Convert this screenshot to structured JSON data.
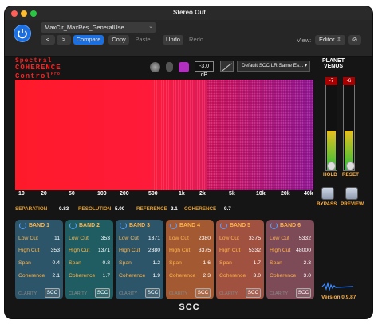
{
  "window": {
    "title": "Stereo Out"
  },
  "host": {
    "preset_name": "MaxClr_MaxRes_GeneralUse",
    "prev_label": "<",
    "next_label": ">",
    "compare_label": "Compare",
    "copy_label": "Copy",
    "paste_label": "Paste",
    "undo_label": "Undo",
    "redo_label": "Redo",
    "view_label": "View:",
    "view_value": "Editor",
    "link_icon": "link-icon",
    "colors": {
      "accent": "#1c6fe0"
    }
  },
  "plugin": {
    "logo": [
      "Spectral",
      "COHERENCE",
      "Control"
    ],
    "logo_suffix": "Pro",
    "db_value": "-3.0 dB",
    "loudness_preset": "Default SCC LR Same Es...",
    "brand": [
      "PLANET",
      "VENUS"
    ],
    "freq_labels": [
      "10",
      "20",
      "50",
      "100",
      "200",
      "500",
      "1k",
      "2k",
      "5k",
      "10k",
      "20k",
      "40k"
    ],
    "params": {
      "separation_label": "SEPARATION",
      "separation_value": "0.83",
      "resolution_label": "RESOLUTION",
      "resolution_value": "5.00",
      "reference_label": "REFERENCE",
      "reference_value": "2.1",
      "coherence_label": "COHERENCE",
      "coherence_value": "9.7"
    },
    "meters": {
      "left": "-7",
      "right": "-6",
      "left_level": 0.45,
      "right_level": 0.45
    },
    "buttons": {
      "hold": "HOLD",
      "reset": "RESET",
      "bypass": "BYPASS",
      "preview": "PREVIEW"
    },
    "bands": [
      {
        "title": "BAND 1",
        "low_cut": "11",
        "high_cut": "353",
        "span": "0.4",
        "coherence": "2.1",
        "color": "#2d5569"
      },
      {
        "title": "BAND 2",
        "low_cut": "353",
        "high_cut": "1371",
        "span": "0.8",
        "coherence": "1.7",
        "color": "#1f5d62"
      },
      {
        "title": "BAND 3",
        "low_cut": "1371",
        "high_cut": "2380",
        "span": "1.2",
        "coherence": "1.9",
        "color": "#2d5569"
      },
      {
        "title": "BAND 4",
        "low_cut": "2380",
        "high_cut": "3375",
        "span": "1.6",
        "coherence": "2.3",
        "color": "#a35a33"
      },
      {
        "title": "BAND 5",
        "low_cut": "3375",
        "high_cut": "5332",
        "span": "1.7",
        "coherence": "3.0",
        "color": "#a05140"
      },
      {
        "title": "BAND 6",
        "low_cut": "5332",
        "high_cut": "48000",
        "span": "2.3",
        "coherence": "3.0",
        "color": "#7d4a57"
      }
    ],
    "band_labels": {
      "low_cut": "Low Cut",
      "high_cut": "High Cut",
      "span": "Span",
      "coherence": "Coherence",
      "clarity": "CLARITY",
      "scc": "SCC"
    },
    "footer": "SCC",
    "version": "Version 0.9.87"
  }
}
